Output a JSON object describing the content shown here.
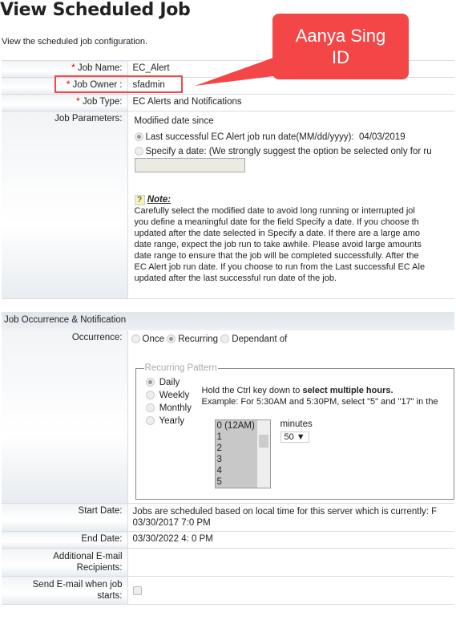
{
  "page": {
    "title": "View Scheduled Job",
    "subtitle": "View the scheduled job configuration."
  },
  "callout": {
    "line1": "Aanya Sing",
    "line2": "ID"
  },
  "fields": {
    "job_name": {
      "label": "Job Name:",
      "value": "EC_Alert"
    },
    "job_owner": {
      "label": "Job Owner :",
      "value": "sfadmin"
    },
    "job_type": {
      "label": "Job Type:",
      "value": "EC Alerts and Notifications"
    },
    "job_parameters": {
      "label": "Job Parameters:",
      "heading": "Modified date since",
      "option_last": "Last successful EC Alert job run date(MM/dd/yyyy):",
      "last_date": "04/03/2019",
      "option_specify": "Specify a date: (We strongly suggest the option be selected only for ru",
      "note_icon": "?",
      "note_title": "Note:",
      "note_lines": [
        "Carefully select the modified date to avoid long running or interrupted jol",
        "you define a meaningful date for the field Specify a date. If you choose th",
        "updated after the date selected in Specify a date. If there are a large amo",
        "date range, expect the job run to take awhile. Please avoid large amounts",
        "date range to ensure that the job will be completed successfully. After the",
        "EC Alert job run date. If you choose to run from the Last successful EC Ale",
        "updated after the last successful run date of the job."
      ]
    }
  },
  "section": {
    "title": "Job Occurrence & Notification"
  },
  "occurrence": {
    "label": "Occurrence:",
    "options": [
      "Once",
      "Recurring",
      "Dependant of"
    ],
    "selected": "Recurring",
    "pattern_legend": "Recurring Pattern",
    "patterns": [
      "Daily",
      "Weekly",
      "Monthly",
      "Yearly"
    ],
    "selected_pattern": "Daily",
    "hint_prefix": "Hold the Ctrl key down to ",
    "hint_bold": "select multiple hours.",
    "example": "Example: For 5:30AM and 5:30PM, select \"5\" and \"17\" in the",
    "hours": [
      "0 (12AM)",
      "1",
      "2",
      "3",
      "4",
      "5"
    ],
    "minutes_label": "minutes",
    "minutes_value": "50 ▼"
  },
  "start_date": {
    "label": "Start Date:",
    "line1": "Jobs are scheduled based on local time for this server which is currently: F",
    "line2": "03/30/2017 7:0 PM"
  },
  "end_date": {
    "label": "End Date:",
    "value": "03/30/2022 4: 0 PM"
  },
  "additional": {
    "label1": "Additional E-mail",
    "label2": "Recipients:"
  },
  "send_email": {
    "label1": "Send E-mail when job",
    "label2": "starts:"
  },
  "required_mark": "*"
}
